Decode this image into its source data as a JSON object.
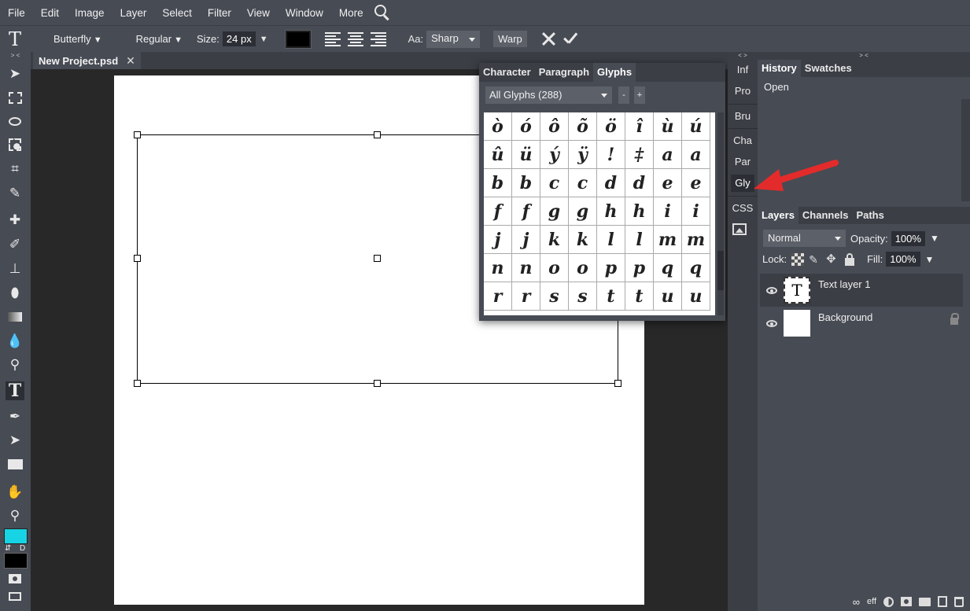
{
  "menubar": {
    "items": [
      "File",
      "Edit",
      "Image",
      "Layer",
      "Select",
      "Filter",
      "View",
      "Window",
      "More"
    ]
  },
  "options": {
    "font_family": "Butterfly",
    "font_style": "Regular",
    "size_label": "Size:",
    "size_value": "24 px",
    "text_color": "#000000",
    "antialias_label": "Aa:",
    "antialias_value": "Sharp",
    "warp_label": "Warp"
  },
  "toolbar": {
    "collapse": "> <",
    "swap_label": "⇵",
    "default_label": "D",
    "foreground_color": "#17d3e3",
    "background_color": "#000000"
  },
  "document": {
    "tab_title": "New Project.psd",
    "close": "✕"
  },
  "glyphs_panel": {
    "tabs": [
      "Character",
      "Paragraph",
      "Glyphs"
    ],
    "active_tab": "Glyphs",
    "glyph_set": "All Glyphs (288)",
    "minus": "-",
    "plus": "+",
    "glyphs": [
      "ò",
      "ó",
      "ô",
      "õ",
      "ö",
      "î",
      "ù",
      "ú",
      "û",
      "ü",
      "ý",
      "ÿ",
      "!",
      "‡",
      "a",
      "a",
      "b",
      "b",
      "c",
      "c",
      "d",
      "d",
      "e",
      "e",
      "f",
      "f",
      "g",
      "g",
      "h",
      "h",
      "i",
      "i",
      "j",
      "j",
      "k",
      "k",
      "l",
      "l",
      "m",
      "m",
      "n",
      "n",
      "o",
      "o",
      "p",
      "p",
      "q",
      "q",
      "r",
      "r",
      "s",
      "s",
      "t",
      "t",
      "u",
      "u"
    ]
  },
  "mini_panels": {
    "collapse": "< >",
    "items": [
      "Inf",
      "Pro",
      "Bru",
      "Cha",
      "Par",
      "Gly",
      "CSS"
    ],
    "active": "Gly"
  },
  "history_panel": {
    "collapse": "> <",
    "tabs": [
      "History",
      "Swatches"
    ],
    "items": [
      "Open"
    ]
  },
  "layers_panel": {
    "tabs": [
      "Layers",
      "Channels",
      "Paths"
    ],
    "blend_mode": "Normal",
    "opacity_label": "Opacity:",
    "opacity_value": "100%",
    "lock_label": "Lock:",
    "fill_label": "Fill:",
    "fill_value": "100%",
    "layers": [
      {
        "name": "Text layer 1",
        "thumb": "T"
      },
      {
        "name": "Background",
        "thumb": ""
      }
    ],
    "footer_eff": "eff"
  },
  "annotation": {
    "arrow_color": "#e32b2b"
  }
}
